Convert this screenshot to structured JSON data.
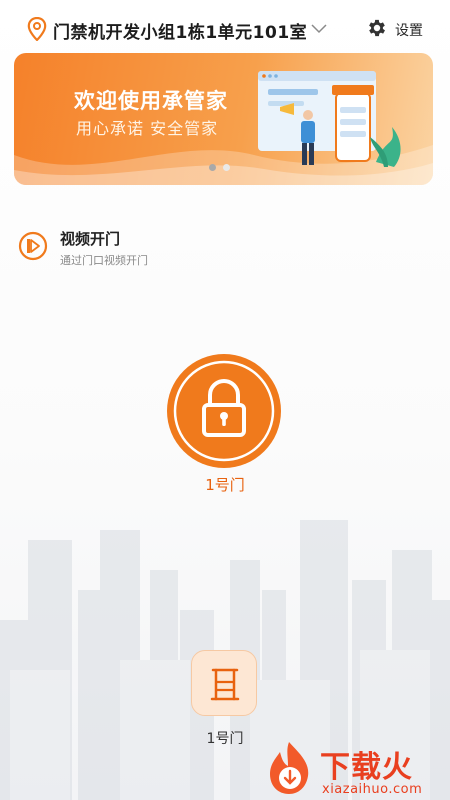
{
  "header": {
    "location_icon": "map-pin-icon",
    "community_name": "门禁机开发小组1栋1单元101室",
    "dropdown_icon": "chevron-down-icon",
    "settings_icon": "gear-icon",
    "settings_label": "设置"
  },
  "banner": {
    "title": "欢迎使用承管家",
    "subtitle": "用心承诺 安全管家",
    "slides": 2,
    "active_slide": 1
  },
  "video_door": {
    "icon": "video-door-icon",
    "title": "视频开门",
    "subtitle": "通过门口视频开门"
  },
  "main_door": {
    "icon": "lock-icon",
    "label": "1号门"
  },
  "door_list": [
    {
      "icon": "door-icon",
      "label": "1号门"
    }
  ],
  "watermark": {
    "brand": "下载火",
    "url": "xiazaihuo.com"
  },
  "colors": {
    "accent": "#f07a1c",
    "accent_dark": "#e8620f",
    "banner_start": "#f5812a",
    "banner_end": "#fbd4a3",
    "watermark": "#e93f1f"
  }
}
